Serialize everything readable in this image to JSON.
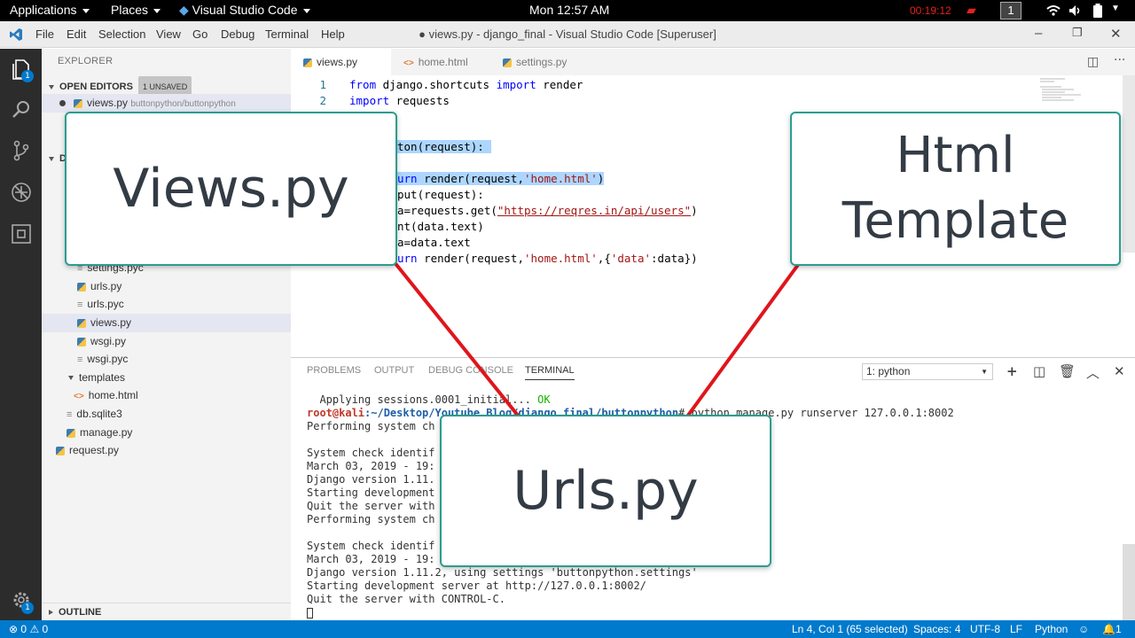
{
  "topbar": {
    "applications": "Applications",
    "places": "Places",
    "app": "Visual Studio Code",
    "clock": "Mon 12:57 AM",
    "timer": "00:19:12",
    "workspace": "1"
  },
  "titlebar": {
    "menu": [
      "File",
      "Edit",
      "Selection",
      "View",
      "Go",
      "Debug",
      "Terminal",
      "Help"
    ],
    "title": "● views.py - django_final - Visual Studio Code [Superuser]"
  },
  "sidebar": {
    "title": "EXPLORER",
    "open_editors": "OPEN EDITORS",
    "unsaved": "1 UNSAVED",
    "open_file": "views.py",
    "open_file_path": "buttonpython/buttonpython",
    "files": [
      {
        "name": "settings.pyc"
      },
      {
        "name": "urls.py"
      },
      {
        "name": "urls.pyc"
      },
      {
        "name": "views.py"
      },
      {
        "name": "wsgi.py"
      },
      {
        "name": "wsgi.pyc"
      },
      {
        "name": "templates"
      },
      {
        "name": "home.html"
      },
      {
        "name": "db.sqlite3"
      },
      {
        "name": "manage.py"
      },
      {
        "name": "request.py"
      }
    ],
    "outline": "OUTLINE",
    "partial_d": "D"
  },
  "tabs": [
    {
      "label": "views.py"
    },
    {
      "label": "home.html"
    },
    {
      "label": "settings.py"
    }
  ],
  "editor": {
    "lines": [
      {
        "n": "1",
        "a": "from",
        "b": " django.shortcuts ",
        "c": "import",
        "d": " render"
      },
      {
        "n": "2",
        "a": "import",
        "b": " requests"
      }
    ],
    "l5": "ton(request):",
    "l7a": "urn",
    "l7b": " render(request,",
    "l7c": "'home.html'",
    "l7d": ")",
    "l8": "put(request):",
    "l9a": "a=requests.get(",
    "l9b": "\"https://reqres.in/api/users\"",
    "l9c": ")",
    "l10": "nt(data.text)",
    "l11": "a=data.text",
    "l12a": "urn",
    "l12b": " render(request,",
    "l12c": "'home.html'",
    "l12d": ",{",
    "l12e": "'data'",
    "l12f": ":data})"
  },
  "panel": {
    "tabs": [
      "PROBLEMS",
      "OUTPUT",
      "DEBUG CONSOLE",
      "TERMINAL"
    ],
    "selector": "1: python"
  },
  "terminal": {
    "t1": "  Applying sessions.0001_initial... ",
    "t1ok": "OK",
    "t2user": "root@kali",
    "t2path": ":~/Desktop/Youtube_Blog/django_final/buttonpython",
    "t2cmd": "# python manage.py runserver 127.0.0.1:8002",
    "t3": "Performing system ch",
    "t5": "System check identif",
    "t6": "March 03, 2019 - 19:",
    "t7": "Django version 1.11.",
    "t8": "Starting development",
    "t9": "Quit the server with",
    "t10": "Performing system ch",
    "t12": "System check identif",
    "t13": "March 03, 2019 - 19:",
    "t14": "Django version 1.11.2, using settings 'buttonpython.settings'",
    "t15": "Starting development server at http://127.0.0.1:8002/",
    "t16": "Quit the server with CONTROL-C."
  },
  "statusbar": {
    "errors": "0",
    "warnings": "0",
    "position": "Ln 4, Col 1 (65 selected)",
    "spaces": "Spaces: 4",
    "encoding": "UTF-8",
    "eol": "LF",
    "language": "Python",
    "notif": "1"
  },
  "overlay": {
    "views": "Views.py",
    "html_1": "Html",
    "html_2": "Template",
    "urls": "Urls.py"
  },
  "colors": {
    "accent": "#007acc",
    "arrow": "#e0151b",
    "callout_border": "#2a9d8f"
  }
}
